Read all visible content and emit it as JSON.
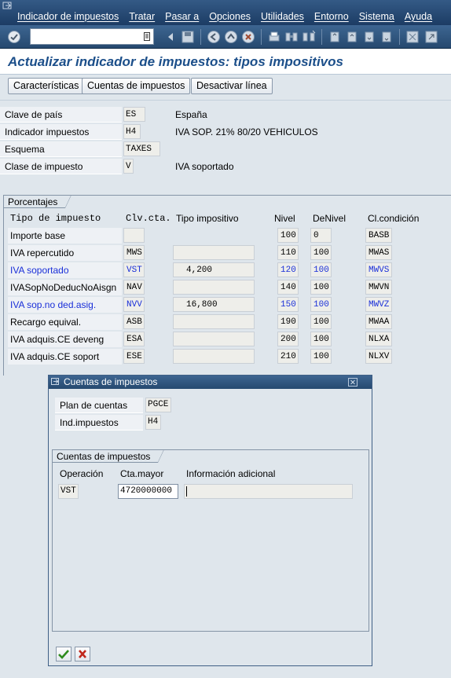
{
  "menu": [
    "Indicador de impuestos",
    "Tratar",
    "Pasar a",
    "Opciones",
    "Utilidades",
    "Entorno",
    "Sistema",
    "Ayuda"
  ],
  "title": "Actualizar indicador de impuestos: tipos impositivos",
  "app_toolbar": {
    "caracteristicas": "Características",
    "cuentas": "Cuentas de impuestos",
    "desactivar": "Desactivar línea"
  },
  "header_fields": {
    "clave_pais": {
      "label": "Clave de país",
      "value": "ES",
      "desc": "España"
    },
    "indicador": {
      "label": "Indicador impuestos",
      "value": "H4",
      "desc": "IVA SOP. 21%  80/20 VEHICULOS"
    },
    "esquema": {
      "label": "Esquema",
      "value": "TAXES"
    },
    "clase": {
      "label": "Clase de impuesto",
      "value": "V",
      "desc": "IVA soportado"
    }
  },
  "porcentajes": {
    "title": "Porcentajes",
    "headers": {
      "tipo": "Tipo de impuesto",
      "clv": "Clv.cta.",
      "tipo_imp": "Tipo impositivo",
      "nivel": "Nivel",
      "denivel": "DeNivel",
      "clcond": "Cl.condición"
    },
    "rows": [
      {
        "tipo": "Importe base",
        "clv": "",
        "rate": "",
        "nivel": "100",
        "denivel": "0",
        "cond": "BASB"
      },
      {
        "tipo": "IVA repercutido",
        "clv": "MWS",
        "rate": "",
        "nivel": "110",
        "denivel": "100",
        "cond": "MWAS"
      },
      {
        "tipo": "IVA soportado",
        "clv": "VST",
        "rate": "4,200",
        "nivel": "120",
        "denivel": "100",
        "cond": "MWVS"
      },
      {
        "tipo": "IVASopNoDeducNoAisgn",
        "clv": "NAV",
        "rate": "",
        "nivel": "140",
        "denivel": "100",
        "cond": "MWVN"
      },
      {
        "tipo": "IVA sop.no ded.asig.",
        "clv": "NVV",
        "rate": "16,800",
        "nivel": "150",
        "denivel": "100",
        "cond": "MWVZ"
      },
      {
        "tipo": "Recargo equival.",
        "clv": "ASB",
        "rate": "",
        "nivel": "190",
        "denivel": "100",
        "cond": "MWAA"
      },
      {
        "tipo": "IVA adquis.CE deveng",
        "clv": "ESA",
        "rate": "",
        "nivel": "200",
        "denivel": "100",
        "cond": "NLXA"
      },
      {
        "tipo": "IVA adquis.CE soport",
        "clv": "ESE",
        "rate": "",
        "nivel": "210",
        "denivel": "100",
        "cond": "NLXV"
      }
    ]
  },
  "dialog": {
    "title": "Cuentas de impuestos",
    "plan_label": "Plan de cuentas",
    "plan_value": "PGCE",
    "ind_label": "Ind.impuestos",
    "ind_value": "H4",
    "group_title": "Cuentas de impuestos",
    "col_operacion": "Operación",
    "col_cta": "Cta.mayor",
    "col_info": "Información adicional",
    "row": {
      "operacion": "VST",
      "cta": "4720000000",
      "info": ""
    }
  },
  "colors": {
    "accent": "#1c4f8a",
    "highlight_blue": "#1a2fd8",
    "menubar": "#26496f"
  }
}
